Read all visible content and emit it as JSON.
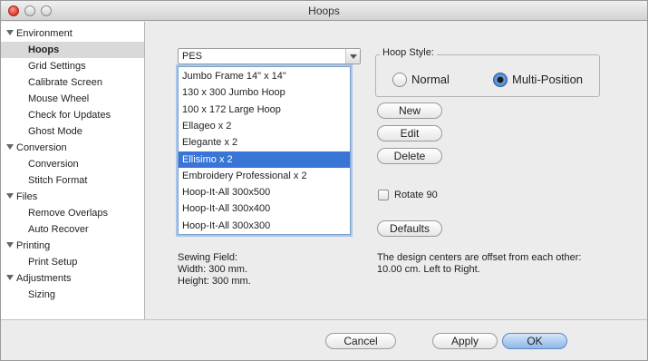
{
  "window": {
    "title": "Hoops"
  },
  "sidebar": {
    "items": [
      {
        "label": "Environment",
        "kind": "group"
      },
      {
        "label": "Hoops",
        "kind": "child",
        "selected": true
      },
      {
        "label": "Grid Settings",
        "kind": "child"
      },
      {
        "label": "Calibrate Screen",
        "kind": "child"
      },
      {
        "label": "Mouse Wheel",
        "kind": "child"
      },
      {
        "label": "Check for Updates",
        "kind": "child"
      },
      {
        "label": "Ghost Mode",
        "kind": "child"
      },
      {
        "label": "Conversion",
        "kind": "group"
      },
      {
        "label": "Conversion",
        "kind": "child"
      },
      {
        "label": "Stitch Format",
        "kind": "child"
      },
      {
        "label": "Files",
        "kind": "group"
      },
      {
        "label": "Remove Overlaps",
        "kind": "child"
      },
      {
        "label": "Auto Recover",
        "kind": "child"
      },
      {
        "label": "Printing",
        "kind": "group"
      },
      {
        "label": "Print Setup",
        "kind": "child"
      },
      {
        "label": "Adjustments",
        "kind": "group"
      },
      {
        "label": "Sizing",
        "kind": "child"
      }
    ]
  },
  "format_select": {
    "value": "PES"
  },
  "hoop_list": {
    "items": [
      "Jumbo Frame 14\" x 14\"",
      "130 x 300 Jumbo Hoop",
      "100 x 172 Large Hoop",
      "Ellageo x 2",
      "Elegante x 2",
      "Ellisimo x 2",
      "Embroidery Professional x 2",
      "Hoop-It-All 300x500",
      "Hoop-It-All 300x400",
      "Hoop-It-All 300x300"
    ],
    "selected_index": 5
  },
  "hoop_style": {
    "label": "Hoop Style:",
    "normal_label": "Normal",
    "multi_label": "Multi-Position",
    "selected": "Multi-Position"
  },
  "buttons": {
    "new": "New",
    "edit": "Edit",
    "delete": "Delete",
    "defaults": "Defaults",
    "cancel": "Cancel",
    "apply": "Apply",
    "ok": "OK"
  },
  "rotate": {
    "label": "Rotate 90",
    "checked": false
  },
  "sewing_field": {
    "title": "Sewing Field:",
    "width": "Width: 300 mm.",
    "height": "Height: 300 mm."
  },
  "offset_note": {
    "line1": "The design centers are offset from each other:",
    "line2": "10.00 cm. Left to Right."
  },
  "colors": {
    "selection": "#3875d7",
    "default_button": "#8fb6e9"
  }
}
